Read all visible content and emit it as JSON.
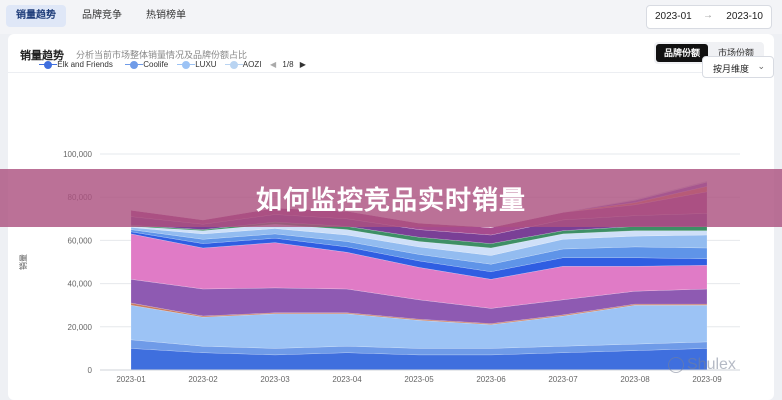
{
  "tabs": [
    {
      "label": "销量趋势",
      "active": true
    },
    {
      "label": "品牌竞争",
      "active": false
    },
    {
      "label": "热销榜单",
      "active": false
    }
  ],
  "date_range": {
    "start": "2023-01",
    "separator": "→",
    "end": "2023-10"
  },
  "card": {
    "title": "销量趋势",
    "subtitle": "分析当前市场整体销量情况及品牌份额占比",
    "toggle": {
      "options": [
        "品牌份额",
        "市场份额"
      ],
      "selected": "品牌份额"
    }
  },
  "legend": {
    "items": [
      "Elk and Friends",
      "Coolife",
      "LUXU",
      "AOZI"
    ],
    "pager": {
      "prev": "◀",
      "text": "1/8",
      "next": "▶"
    }
  },
  "dimension_select": {
    "label": "按月维度",
    "icon": "chevron-down-icon"
  },
  "banner": {
    "text": "如何监控竞品实时销量"
  },
  "watermark": {
    "text": "Shulex"
  },
  "colors": {
    "accent": "#111111",
    "banner": "#ac5280",
    "tab_active_bg": "#dfe7f7"
  },
  "chart_data": {
    "type": "area",
    "stacked": true,
    "ylabel": "销量",
    "ylim": [
      0,
      100000
    ],
    "yticks": [
      "0",
      "20,000",
      "40,000",
      "60,000",
      "80,000",
      "100,000"
    ],
    "categories": [
      "2023-01",
      "2023-02",
      "2023-03",
      "2023-04",
      "2023-05",
      "2023-06",
      "2023-07",
      "2023-08",
      "2023-09"
    ],
    "grid": true,
    "series": [
      {
        "color": "#3f6fde",
        "values": [
          10000,
          8000,
          7000,
          8000,
          7000,
          7000,
          8000,
          9000,
          10000
        ]
      },
      {
        "color": "#6f9be8",
        "values": [
          4000,
          3000,
          3000,
          3000,
          3000,
          3000,
          3000,
          3000,
          3000
        ]
      },
      {
        "color": "#9cc3f5",
        "values": [
          16000,
          13500,
          16000,
          15000,
          13000,
          11000,
          14000,
          18000,
          17000
        ]
      },
      {
        "color": "#c97a5e",
        "values": [
          1000,
          500,
          500,
          500,
          500,
          500,
          500,
          500,
          500
        ]
      },
      {
        "color": "#8e5ab2",
        "values": [
          11000,
          12500,
          11500,
          11000,
          9000,
          7000,
          7000,
          6000,
          7000
        ]
      },
      {
        "color": "#e07bc6",
        "values": [
          21000,
          19000,
          21000,
          17000,
          15000,
          13500,
          15500,
          11500,
          11000
        ]
      },
      {
        "color": "#2f5ee2",
        "values": [
          1000,
          2000,
          2000,
          2500,
          3000,
          3500,
          4000,
          4000,
          3000
        ]
      },
      {
        "color": "#5f94e8",
        "values": [
          1000,
          2000,
          2000,
          2500,
          3000,
          3500,
          4000,
          5000,
          5000
        ]
      },
      {
        "color": "#93bcf0",
        "values": [
          1000,
          2500,
          2500,
          3000,
          3500,
          4000,
          4500,
          5000,
          6000
        ]
      },
      {
        "color": "#cfe0f8",
        "values": [
          500,
          1500,
          2000,
          2500,
          2500,
          3500,
          2500,
          2500,
          2000
        ]
      },
      {
        "color": "#3e8f66",
        "values": [
          500,
          500,
          1000,
          1500,
          2000,
          2000,
          1500,
          2000,
          2000
        ]
      },
      {
        "color": "#7a3f96",
        "values": [
          4000,
          2500,
          3500,
          3500,
          3500,
          4000,
          5000,
          5000,
          6000
        ]
      },
      {
        "color": "#a74b8e",
        "values": [
          3000,
          2000,
          3000,
          3500,
          3000,
          3500,
          3500,
          5000,
          10000
        ]
      },
      {
        "color": "#e8864f",
        "values": [
          0,
          0,
          0,
          0,
          0,
          0,
          0,
          1000,
          2500
        ]
      },
      {
        "color": "#8a6bd0",
        "values": [
          0,
          0,
          0,
          0,
          0,
          0,
          0,
          1000,
          2000
        ]
      },
      {
        "color": "#c9cfe0",
        "values": [
          0,
          0,
          0,
          0,
          0,
          0,
          0,
          500,
          500
        ]
      }
    ]
  }
}
